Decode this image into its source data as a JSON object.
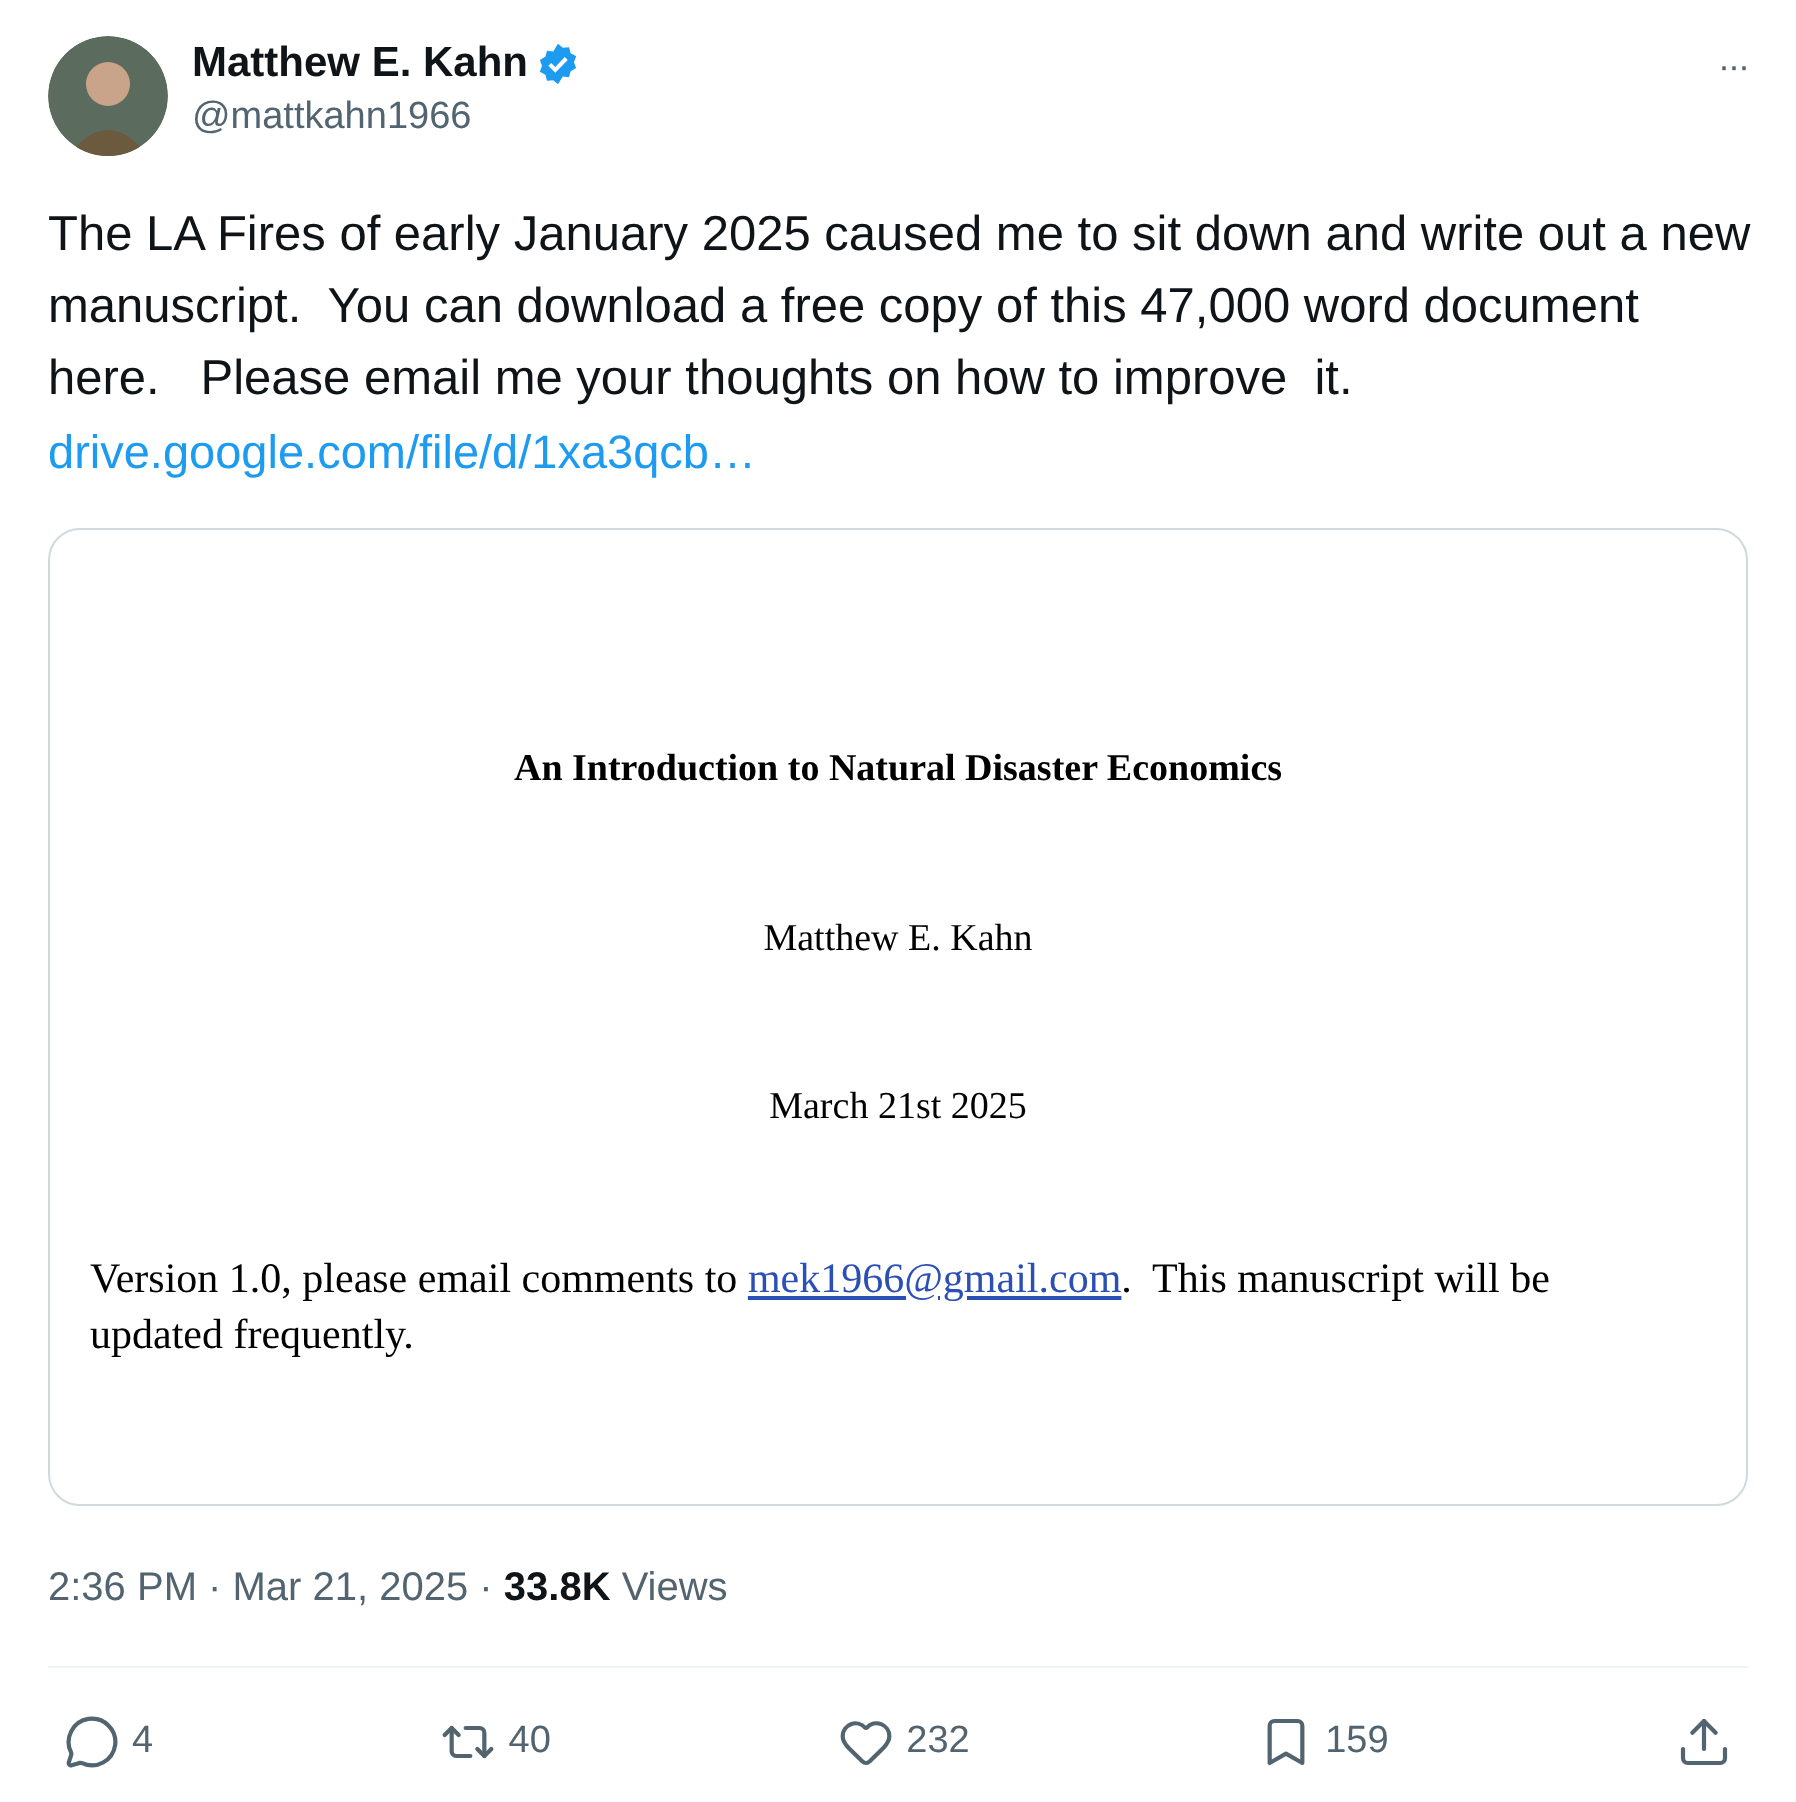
{
  "author": {
    "name": "Matthew E. Kahn",
    "verified": true,
    "handle": "@mattkahn1966"
  },
  "more_button": "···",
  "body": {
    "text": "The LA Fires of early January 2025 caused me to sit down and write out a new manuscript.  You can download a free copy of this 47,000 word document here.   Please email me your thoughts on how to improve  it.",
    "link": "drive.google.com/file/d/1xa3qcb…"
  },
  "document": {
    "title": "An Introduction to Natural Disaster Economics",
    "author": "Matthew E. Kahn",
    "date": "March 21st 2025",
    "note_before": "Version 1.0, please email comments to ",
    "email": "mek1966@gmail.com",
    "note_after": ".  This manuscript will be updated frequently."
  },
  "meta": "2:36 PM · Mar 21, 2025 · **33.8K** Views",
  "actions": [
    {
      "kind": "reply",
      "count": "4"
    },
    {
      "kind": "repost",
      "count": "40"
    },
    {
      "kind": "like",
      "count": "232"
    },
    {
      "kind": "bookmark",
      "count": "159"
    },
    {
      "kind": "share"
    }
  ]
}
